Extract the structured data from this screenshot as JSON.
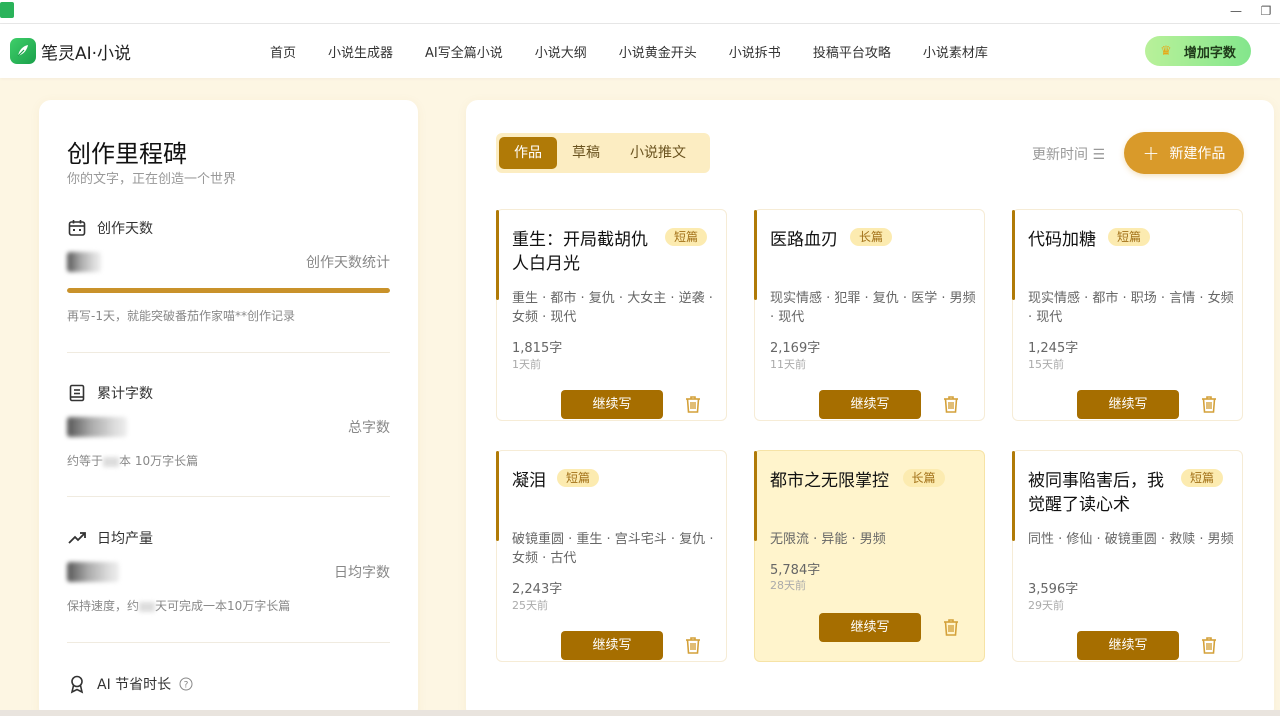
{
  "header": {
    "logo_text": "笔灵AI·小说",
    "nav": [
      "首页",
      "小说生成器",
      "AI写全篇小说",
      "小说大纲",
      "小说黄金开头",
      "小说拆书",
      "投稿平台攻略",
      "小说素材库"
    ],
    "add_words_label": "增加字数"
  },
  "left": {
    "title": "创作里程碑",
    "subtitle": "你的文字，正在创造一个世界",
    "days": {
      "label": "创作天数",
      "right_label": "创作天数统计",
      "note": "再写-1天，就能突破番茄作家喵**创作记录"
    },
    "words": {
      "label": "累计字数",
      "right_label": "总字数",
      "note_prefix": "约等于",
      "note_suffix": "本 10万字长篇"
    },
    "daily": {
      "label": "日均产量",
      "right_label": "日均字数",
      "note_prefix": "保持速度，约",
      "note_suffix": "天可完成一本10万字长篇"
    },
    "saved": {
      "label": "AI 节省时长"
    }
  },
  "right": {
    "tabs": [
      "作品",
      "草稿",
      "小说推文"
    ],
    "active_tab": 0,
    "sort_label": "更新时间 ☰",
    "new_work_label": "新建作品",
    "continue_label": "继续写",
    "cards": [
      {
        "title": "重生：开局截胡仇人白月光",
        "badge": "短篇",
        "tags": "重生 · 都市 · 复仇 · 大女主 · 逆袭 · 女频 · 现代",
        "words": "1,815字",
        "time": "1天前",
        "highlight": false
      },
      {
        "title": "医路血刃",
        "badge": "长篇",
        "tags": "现实情感 · 犯罪 · 复仇 · 医学 · 男频 · 现代",
        "words": "2,169字",
        "time": "11天前",
        "highlight": false
      },
      {
        "title": "代码加糖",
        "badge": "短篇",
        "tags": "现实情感 · 都市 · 职场 · 言情 · 女频 · 现代",
        "words": "1,245字",
        "time": "15天前",
        "highlight": false
      },
      {
        "title": "凝泪",
        "badge": "短篇",
        "tags": "破镜重圆 · 重生 · 宫斗宅斗 · 复仇 · 女频 · 古代",
        "words": "2,243字",
        "time": "25天前",
        "highlight": false
      },
      {
        "title": "都市之无限掌控",
        "badge": "长篇",
        "tags": "无限流 · 异能 · 男频",
        "words": "5,784字",
        "time": "28天前",
        "highlight": true
      },
      {
        "title": "被同事陷害后，我觉醒了读心术",
        "badge": "短篇",
        "tags": "同性 · 修仙 · 破镜重圆 · 救赎 · 男频",
        "words": "3,596字",
        "time": "29天前",
        "highlight": false
      }
    ]
  },
  "colors": {
    "accent": "#b07a07",
    "accent_light": "#fcedc2",
    "new_button": "#d99a2a",
    "green": "#83e68c"
  }
}
